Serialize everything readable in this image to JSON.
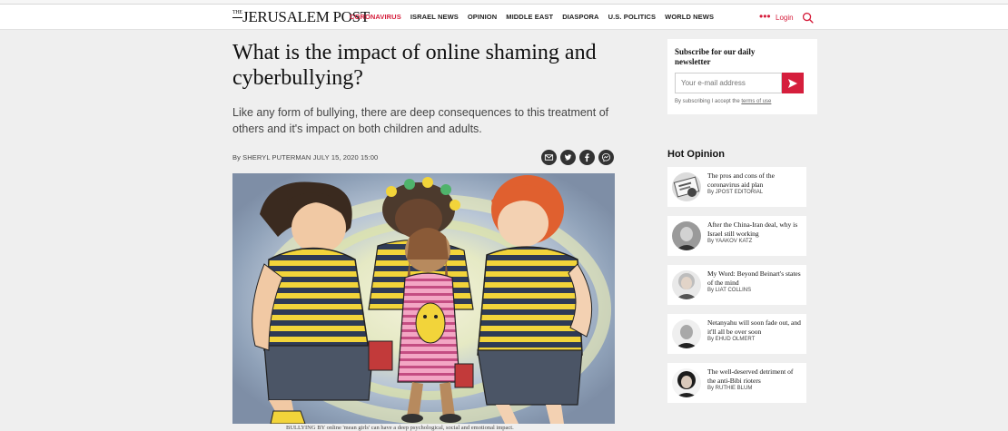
{
  "site": {
    "logo_the": "THE",
    "logo_name": "JERUSALEM POST",
    "nav": [
      "CORONAVIRUS",
      "ISRAEL NEWS",
      "OPINION",
      "MIDDLE EAST",
      "DIASPORA",
      "U.S. POLITICS",
      "WORLD NEWS"
    ],
    "more_label": "•••",
    "login_label": "Login",
    "accent": "#d51e3c"
  },
  "article": {
    "headline": "What is the impact of online shaming and cyberbullying?",
    "subhead": "Like any form of bullying, there are deep consequences to this treatment of others and it's impact on both children and adults.",
    "byline": "By SHERYL PUTERMAN   JULY 15, 2020 15:00",
    "share_icons": [
      "email-icon",
      "twitter-icon",
      "facebook-icon",
      "messenger-icon"
    ],
    "caption": "BULLYING BY online 'mean girls' can have a deep psychological, social and emotional impact."
  },
  "newsletter": {
    "title": "Subscribe for our daily newsletter",
    "placeholder": "Your e-mail address",
    "terms_prefix": "By subscribing I accept the ",
    "terms_link": "terms of use"
  },
  "hot_opinion": {
    "title": "Hot Opinion",
    "items": [
      {
        "headline": "The pros and cons of the coronavirus aid plan",
        "author": "By JPOST EDITORIAL"
      },
      {
        "headline": "After the China-Iran deal, why is Israel still working",
        "author": "By YAAKOV KATZ"
      },
      {
        "headline": "My Word: Beyond Beinart's states of the mind",
        "author": "By LIAT COLLINS"
      },
      {
        "headline": "Netanyahu will soon fade out, and it'll all be over soon",
        "author": "By EHUD OLMERT"
      },
      {
        "headline": "The well-deserved detriment of the anti-Bibi rioters",
        "author": "By RUTHIE BLUM"
      }
    ]
  }
}
